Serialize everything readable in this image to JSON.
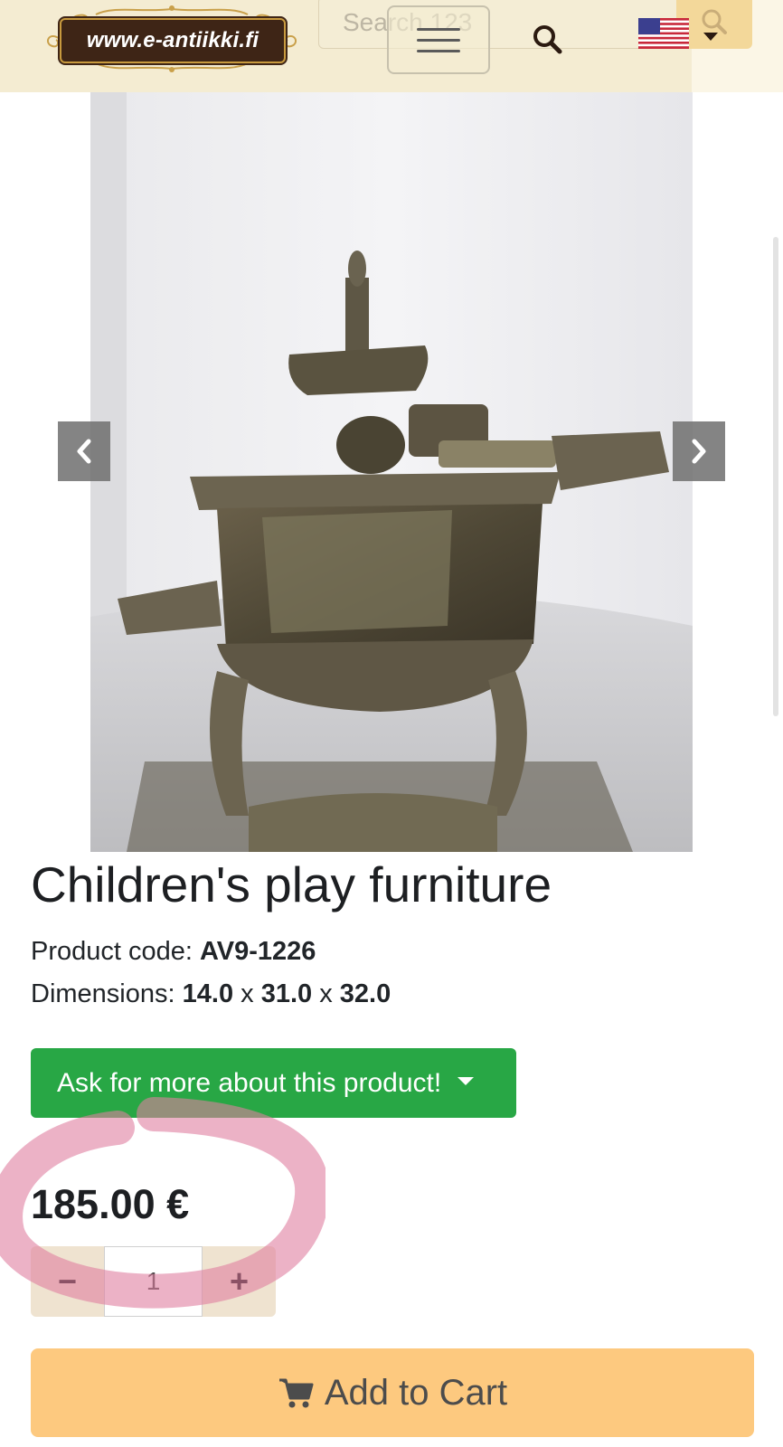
{
  "header": {
    "logo_text": "www.e-antiikki.fi",
    "search_placeholder": "Search 123",
    "language_flag": "us-flag-icon"
  },
  "gallery": {
    "prev_icon": "chevron-left-icon",
    "next_icon": "chevron-right-icon",
    "image_alt": "Cast iron toy stove"
  },
  "product": {
    "title": "Children's play furniture",
    "code_label": "Product code: ",
    "code_value": "AV9-1226",
    "dimensions_label": "Dimensions: ",
    "dim_1": "14.0",
    "dim_sep_1": " x ",
    "dim_2": "31.0",
    "dim_sep_2": " x ",
    "dim_3": "32.0",
    "ask_button": "Ask for more about this product!",
    "price": "185.00 €",
    "quantity_minus": "−",
    "quantity_value": "1",
    "quantity_plus": "+",
    "add_to_cart": "Add to Cart"
  },
  "colors": {
    "header_bg": "#f4ecd2",
    "ask_button_bg": "#28a745",
    "add_to_cart_bg": "#fdc97f",
    "highlight_mark": "#e07fa0"
  }
}
